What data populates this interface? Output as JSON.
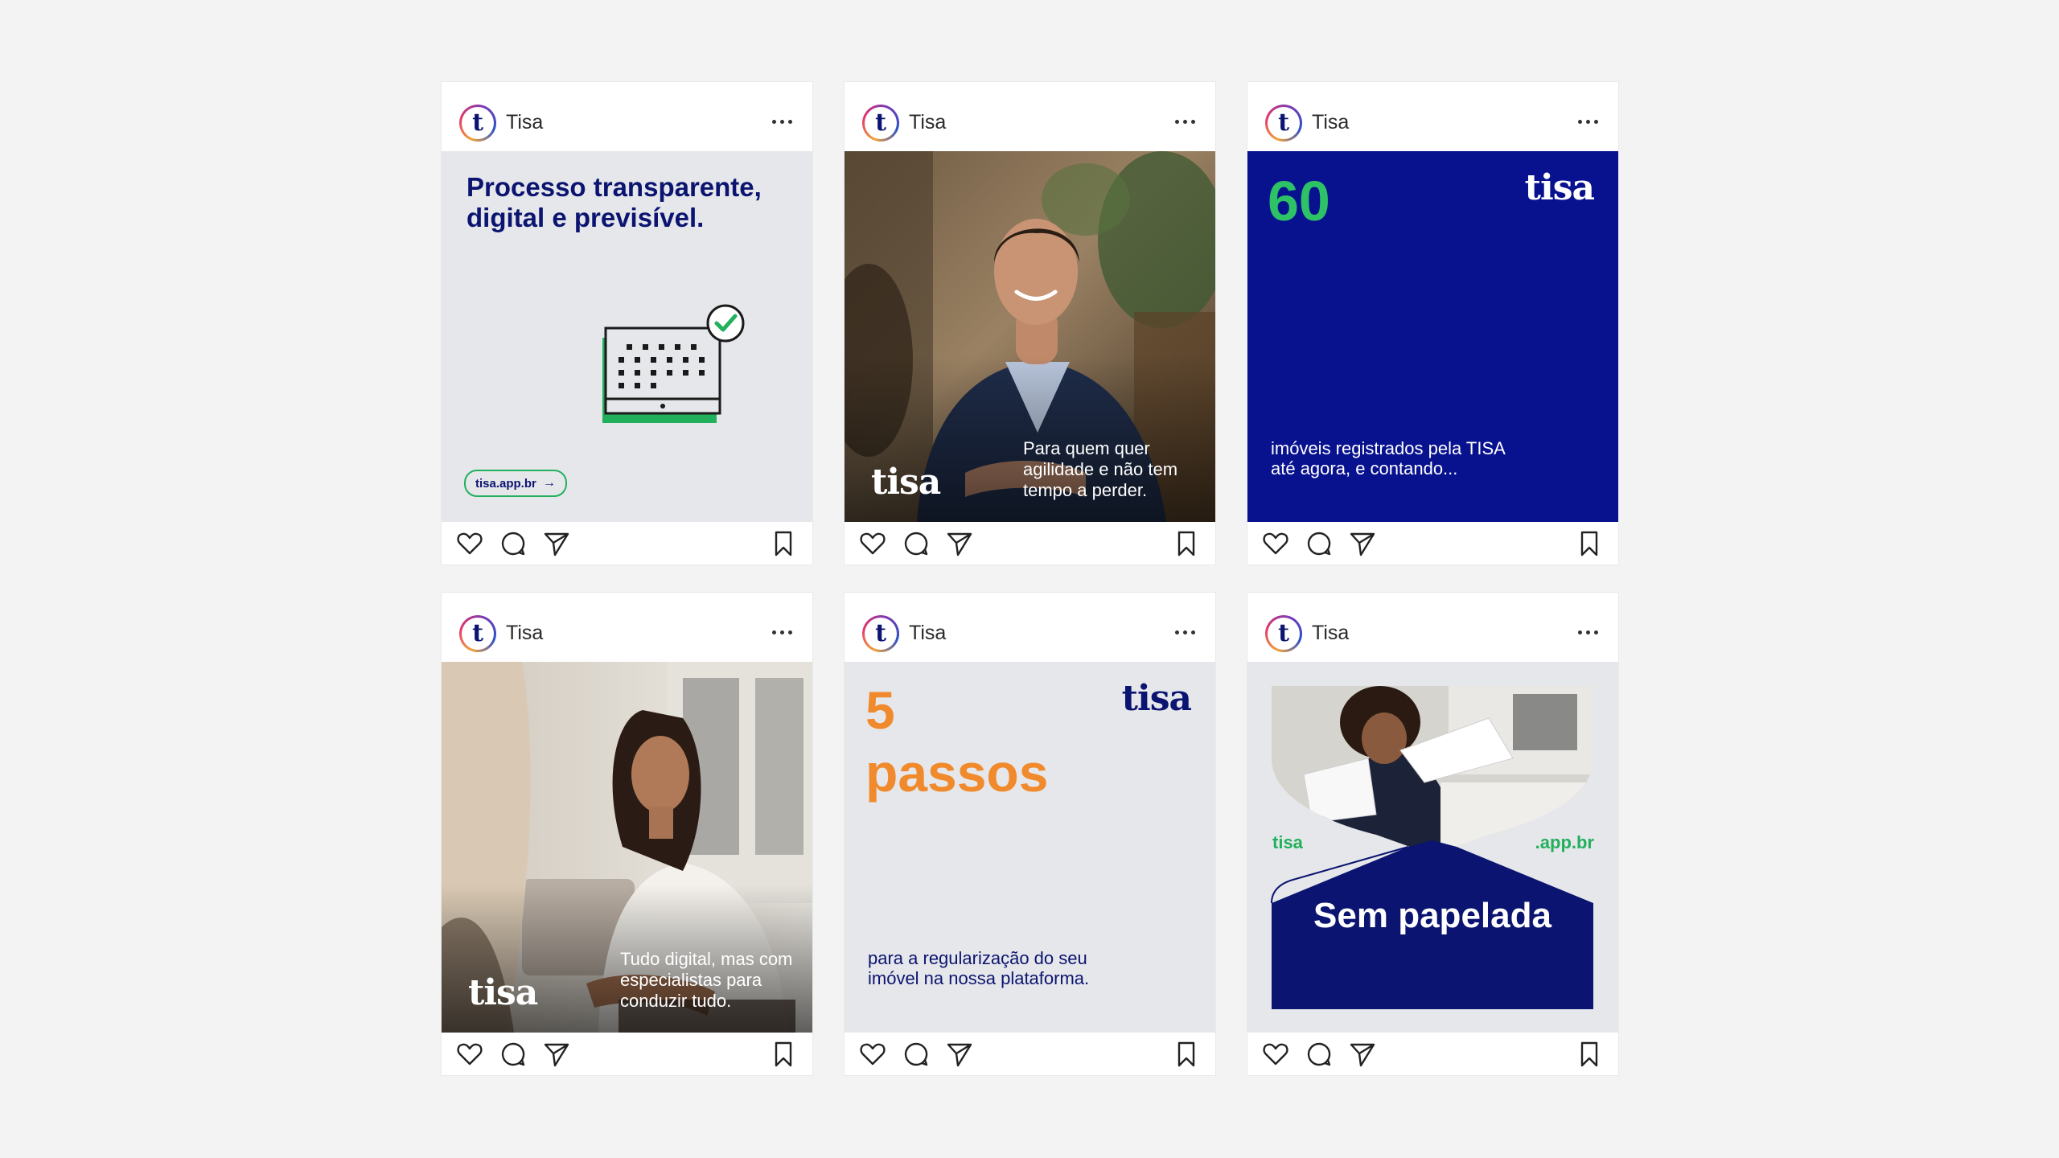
{
  "account": {
    "name": "Tisa",
    "avatar_letter": "t",
    "brand_color": "#0b1470"
  },
  "icons": {
    "more": "more-horizontal-icon",
    "like": "heart-icon",
    "comment": "comment-icon",
    "share": "send-icon",
    "save": "bookmark-icon"
  },
  "posts": [
    {
      "title": "Processo transparente, digital e previsível.",
      "url_label": "tisa.app.br",
      "url_arrow": "→",
      "illustration": "calendar-check-icon",
      "accent": "#22b05d"
    },
    {
      "wordmark": "tisa",
      "caption": "Para quem quer agilidade e não tem tempo a perder."
    },
    {
      "number": "60",
      "wordmark": "tisa",
      "body": "imóveis registrados pela TISA até agora, e contando...",
      "background": "#08128f",
      "number_color": "#2ec267"
    },
    {
      "wordmark": "tisa",
      "caption": "Tudo digital, mas com especialistas para conduzir tudo."
    },
    {
      "number": "5",
      "subtitle": "passos",
      "wordmark": "tisa",
      "body": "para a regularização do seu imóvel na nossa plataforma.",
      "accent": "#f08a2c"
    },
    {
      "tag_left": "tisa",
      "tag_right": ".app.br",
      "title": "Sem papelada",
      "panel_color": "#0b1470"
    }
  ]
}
